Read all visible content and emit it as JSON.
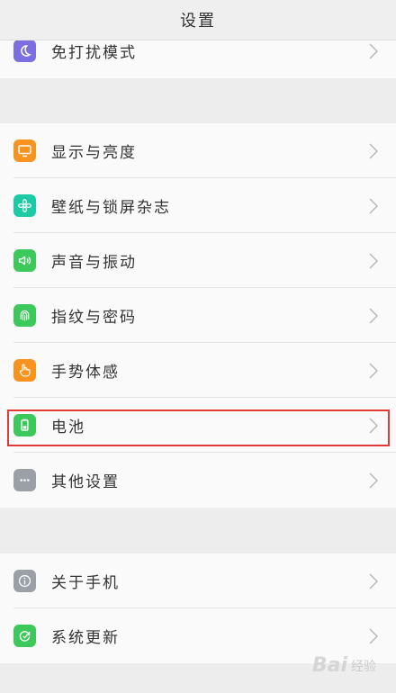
{
  "header": {
    "title": "设置"
  },
  "groups": [
    {
      "items": [
        {
          "label": "免打扰模式",
          "icon": "moon-icon",
          "color": "#7b6fe0"
        }
      ]
    },
    {
      "items": [
        {
          "label": "显示与亮度",
          "icon": "display-icon",
          "color": "#f7931e"
        },
        {
          "label": "壁纸与锁屏杂志",
          "icon": "flower-icon",
          "color": "#1ccaa6"
        },
        {
          "label": "声音与振动",
          "icon": "speaker-icon",
          "color": "#3cc85a"
        },
        {
          "label": "指纹与密码",
          "icon": "fingerprint-icon",
          "color": "#3cc85a"
        },
        {
          "label": "手势体感",
          "icon": "hand-icon",
          "color": "#f7931e"
        },
        {
          "label": "电池",
          "icon": "battery-icon",
          "color": "#3cc85a"
        },
        {
          "label": "其他设置",
          "icon": "more-icon",
          "color": "#9aa0a6"
        }
      ]
    },
    {
      "items": [
        {
          "label": "关于手机",
          "icon": "info-icon",
          "color": "#9aa0a6"
        },
        {
          "label": "系统更新",
          "icon": "update-icon",
          "color": "#3cc85a"
        }
      ]
    }
  ],
  "watermark": {
    "brand": "Bai",
    "suffix": "经验"
  }
}
